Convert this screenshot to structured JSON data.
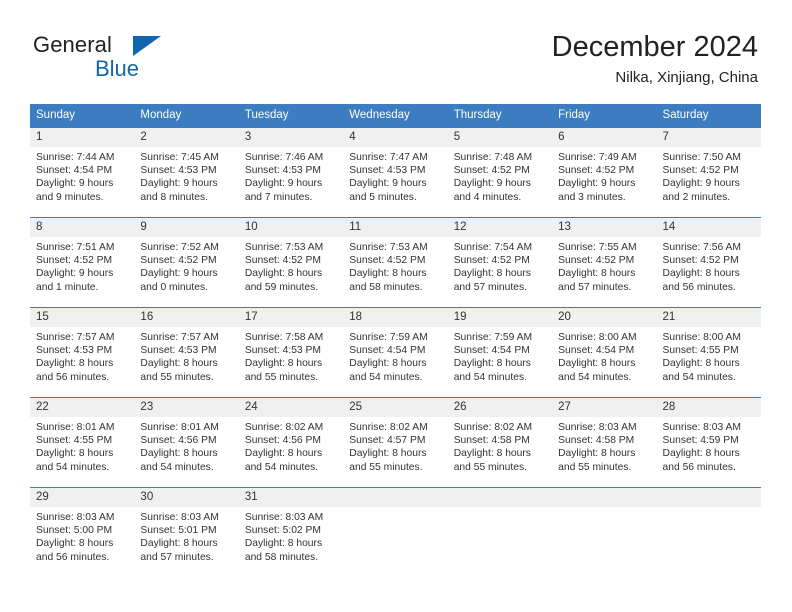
{
  "brand": {
    "line1": "General",
    "line2": "Blue",
    "triangle_color": "#1266ad",
    "icon": "triangle-logo-icon"
  },
  "header": {
    "title": "December 2024",
    "location": "Nilka, Xinjiang, China"
  },
  "theme": {
    "header_blue": "#3b7dc0",
    "daynum_gray": "#f0f0f0",
    "text": "#333333"
  },
  "calendar": {
    "weekday_headers": [
      "Sunday",
      "Monday",
      "Tuesday",
      "Wednesday",
      "Thursday",
      "Friday",
      "Saturday"
    ],
    "weeks": [
      [
        {
          "day": "1",
          "sunrise": "Sunrise: 7:44 AM",
          "sunset": "Sunset: 4:54 PM",
          "daylight1": "Daylight: 9 hours",
          "daylight2": "and 9 minutes."
        },
        {
          "day": "2",
          "sunrise": "Sunrise: 7:45 AM",
          "sunset": "Sunset: 4:53 PM",
          "daylight1": "Daylight: 9 hours",
          "daylight2": "and 8 minutes."
        },
        {
          "day": "3",
          "sunrise": "Sunrise: 7:46 AM",
          "sunset": "Sunset: 4:53 PM",
          "daylight1": "Daylight: 9 hours",
          "daylight2": "and 7 minutes."
        },
        {
          "day": "4",
          "sunrise": "Sunrise: 7:47 AM",
          "sunset": "Sunset: 4:53 PM",
          "daylight1": "Daylight: 9 hours",
          "daylight2": "and 5 minutes."
        },
        {
          "day": "5",
          "sunrise": "Sunrise: 7:48 AM",
          "sunset": "Sunset: 4:52 PM",
          "daylight1": "Daylight: 9 hours",
          "daylight2": "and 4 minutes."
        },
        {
          "day": "6",
          "sunrise": "Sunrise: 7:49 AM",
          "sunset": "Sunset: 4:52 PM",
          "daylight1": "Daylight: 9 hours",
          "daylight2": "and 3 minutes."
        },
        {
          "day": "7",
          "sunrise": "Sunrise: 7:50 AM",
          "sunset": "Sunset: 4:52 PM",
          "daylight1": "Daylight: 9 hours",
          "daylight2": "and 2 minutes."
        }
      ],
      [
        {
          "day": "8",
          "sunrise": "Sunrise: 7:51 AM",
          "sunset": "Sunset: 4:52 PM",
          "daylight1": "Daylight: 9 hours",
          "daylight2": "and 1 minute."
        },
        {
          "day": "9",
          "sunrise": "Sunrise: 7:52 AM",
          "sunset": "Sunset: 4:52 PM",
          "daylight1": "Daylight: 9 hours",
          "daylight2": "and 0 minutes."
        },
        {
          "day": "10",
          "sunrise": "Sunrise: 7:53 AM",
          "sunset": "Sunset: 4:52 PM",
          "daylight1": "Daylight: 8 hours",
          "daylight2": "and 59 minutes."
        },
        {
          "day": "11",
          "sunrise": "Sunrise: 7:53 AM",
          "sunset": "Sunset: 4:52 PM",
          "daylight1": "Daylight: 8 hours",
          "daylight2": "and 58 minutes."
        },
        {
          "day": "12",
          "sunrise": "Sunrise: 7:54 AM",
          "sunset": "Sunset: 4:52 PM",
          "daylight1": "Daylight: 8 hours",
          "daylight2": "and 57 minutes."
        },
        {
          "day": "13",
          "sunrise": "Sunrise: 7:55 AM",
          "sunset": "Sunset: 4:52 PM",
          "daylight1": "Daylight: 8 hours",
          "daylight2": "and 57 minutes."
        },
        {
          "day": "14",
          "sunrise": "Sunrise: 7:56 AM",
          "sunset": "Sunset: 4:52 PM",
          "daylight1": "Daylight: 8 hours",
          "daylight2": "and 56 minutes."
        }
      ],
      [
        {
          "day": "15",
          "sunrise": "Sunrise: 7:57 AM",
          "sunset": "Sunset: 4:53 PM",
          "daylight1": "Daylight: 8 hours",
          "daylight2": "and 56 minutes."
        },
        {
          "day": "16",
          "sunrise": "Sunrise: 7:57 AM",
          "sunset": "Sunset: 4:53 PM",
          "daylight1": "Daylight: 8 hours",
          "daylight2": "and 55 minutes."
        },
        {
          "day": "17",
          "sunrise": "Sunrise: 7:58 AM",
          "sunset": "Sunset: 4:53 PM",
          "daylight1": "Daylight: 8 hours",
          "daylight2": "and 55 minutes."
        },
        {
          "day": "18",
          "sunrise": "Sunrise: 7:59 AM",
          "sunset": "Sunset: 4:54 PM",
          "daylight1": "Daylight: 8 hours",
          "daylight2": "and 54 minutes."
        },
        {
          "day": "19",
          "sunrise": "Sunrise: 7:59 AM",
          "sunset": "Sunset: 4:54 PM",
          "daylight1": "Daylight: 8 hours",
          "daylight2": "and 54 minutes."
        },
        {
          "day": "20",
          "sunrise": "Sunrise: 8:00 AM",
          "sunset": "Sunset: 4:54 PM",
          "daylight1": "Daylight: 8 hours",
          "daylight2": "and 54 minutes."
        },
        {
          "day": "21",
          "sunrise": "Sunrise: 8:00 AM",
          "sunset": "Sunset: 4:55 PM",
          "daylight1": "Daylight: 8 hours",
          "daylight2": "and 54 minutes."
        }
      ],
      [
        {
          "day": "22",
          "sunrise": "Sunrise: 8:01 AM",
          "sunset": "Sunset: 4:55 PM",
          "daylight1": "Daylight: 8 hours",
          "daylight2": "and 54 minutes."
        },
        {
          "day": "23",
          "sunrise": "Sunrise: 8:01 AM",
          "sunset": "Sunset: 4:56 PM",
          "daylight1": "Daylight: 8 hours",
          "daylight2": "and 54 minutes."
        },
        {
          "day": "24",
          "sunrise": "Sunrise: 8:02 AM",
          "sunset": "Sunset: 4:56 PM",
          "daylight1": "Daylight: 8 hours",
          "daylight2": "and 54 minutes."
        },
        {
          "day": "25",
          "sunrise": "Sunrise: 8:02 AM",
          "sunset": "Sunset: 4:57 PM",
          "daylight1": "Daylight: 8 hours",
          "daylight2": "and 55 minutes."
        },
        {
          "day": "26",
          "sunrise": "Sunrise: 8:02 AM",
          "sunset": "Sunset: 4:58 PM",
          "daylight1": "Daylight: 8 hours",
          "daylight2": "and 55 minutes."
        },
        {
          "day": "27",
          "sunrise": "Sunrise: 8:03 AM",
          "sunset": "Sunset: 4:58 PM",
          "daylight1": "Daylight: 8 hours",
          "daylight2": "and 55 minutes."
        },
        {
          "day": "28",
          "sunrise": "Sunrise: 8:03 AM",
          "sunset": "Sunset: 4:59 PM",
          "daylight1": "Daylight: 8 hours",
          "daylight2": "and 56 minutes."
        }
      ],
      [
        {
          "day": "29",
          "sunrise": "Sunrise: 8:03 AM",
          "sunset": "Sunset: 5:00 PM",
          "daylight1": "Daylight: 8 hours",
          "daylight2": "and 56 minutes."
        },
        {
          "day": "30",
          "sunrise": "Sunrise: 8:03 AM",
          "sunset": "Sunset: 5:01 PM",
          "daylight1": "Daylight: 8 hours",
          "daylight2": "and 57 minutes."
        },
        {
          "day": "31",
          "sunrise": "Sunrise: 8:03 AM",
          "sunset": "Sunset: 5:02 PM",
          "daylight1": "Daylight: 8 hours",
          "daylight2": "and 58 minutes."
        },
        {
          "day": "",
          "sunrise": "",
          "sunset": "",
          "daylight1": "",
          "daylight2": ""
        },
        {
          "day": "",
          "sunrise": "",
          "sunset": "",
          "daylight1": "",
          "daylight2": ""
        },
        {
          "day": "",
          "sunrise": "",
          "sunset": "",
          "daylight1": "",
          "daylight2": ""
        },
        {
          "day": "",
          "sunrise": "",
          "sunset": "",
          "daylight1": "",
          "daylight2": ""
        }
      ]
    ]
  }
}
